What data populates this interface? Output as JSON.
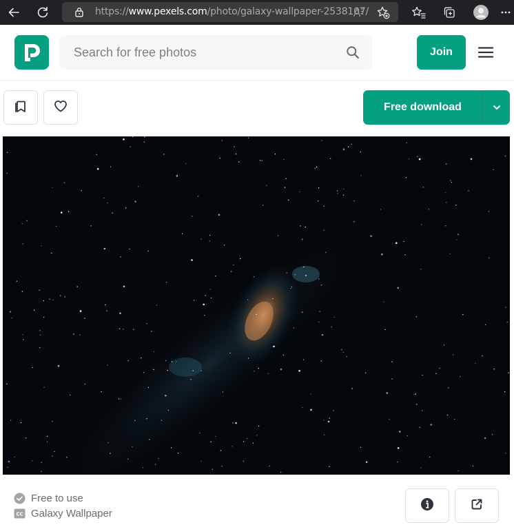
{
  "browser": {
    "url_prefix": "https://",
    "url_host": "www.pexels.com",
    "url_path": "/photo/galaxy-wallpaper-2538107/",
    "icons": [
      "back-arrow-icon",
      "refresh-icon",
      "lock-icon",
      "read-aloud-icon",
      "add-favorite-icon",
      "favorites-icon",
      "collections-icon",
      "profile-icon",
      "more-icon"
    ]
  },
  "header": {
    "search_placeholder": "Search for free photos",
    "join_label": "Join",
    "brand_color": "#05a081"
  },
  "actions": {
    "download_label": "Free download",
    "icons": [
      "bookmark-icon",
      "heart-icon",
      "chevron-down-icon"
    ]
  },
  "photo": {
    "subject": "galaxy-wallpaper-photo"
  },
  "footer": {
    "license_label": "Free to use",
    "title": "Galaxy Wallpaper",
    "icons": [
      "check-circle-icon",
      "cc-icon",
      "info-icon",
      "share-icon"
    ]
  }
}
